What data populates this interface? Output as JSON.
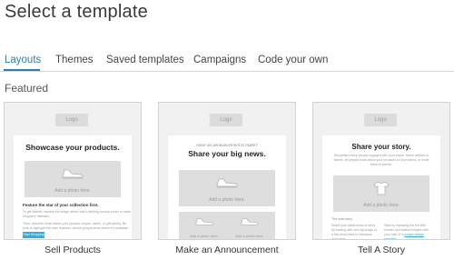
{
  "page": {
    "title": "Select a template"
  },
  "tabs": [
    {
      "label": "Layouts",
      "active": true
    },
    {
      "label": "Themes",
      "active": false
    },
    {
      "label": "Saved templates",
      "active": false
    },
    {
      "label": "Campaigns",
      "active": false
    },
    {
      "label": "Code your own",
      "active": false
    }
  ],
  "section": {
    "label": "Featured"
  },
  "colors": {
    "accent": "#2a7ea8",
    "cta": "#2baee0",
    "panel": "#f1f1f1"
  },
  "cards": [
    {
      "label": "Sell Products",
      "logo": "Logo",
      "headline": "Showcase your products.",
      "photo_caption": "Add a photo here.",
      "feature_heading": "Feature the star of your collection first.",
      "body_1": "To get started, replace the image above with a striking product photo to catch shoppers' attention.",
      "body_2": "Then, describe what makes your product unique, useful, or gift-worthy. Be sure to highlight the main features, and let people know where it's available.",
      "button": "Start Shopping",
      "icon": "shoe-icon"
    },
    {
      "label": "Make an Announcement",
      "logo": "Logo",
      "pre_headline": "Have an announcement to make?",
      "headline": "Share your big news.",
      "photo_caption": "Add a photo here.",
      "small_photo_caption_left": "Add a photo here.",
      "small_photo_caption_right": "Add a photo here.",
      "icon": "shoe-icon"
    },
    {
      "label": "Tell A Story",
      "logo": "Logo",
      "headline": "Share your story.",
      "intro": "Storytellers keep people engaged with your brand. Share articles or stories, let people know about your products or promotions, or invite them to events.",
      "photo_caption": "Add a photo here.",
      "col_heading": "The main story",
      "col_left": "Share your latest news or story by leading with one big image or a few short lines to introduce your news.",
      "col_right": "Start by replacing the fun with header and feature images with your own or a ",
      "col_link": "unique design template",
      "icon": "shirt-icon"
    }
  ]
}
